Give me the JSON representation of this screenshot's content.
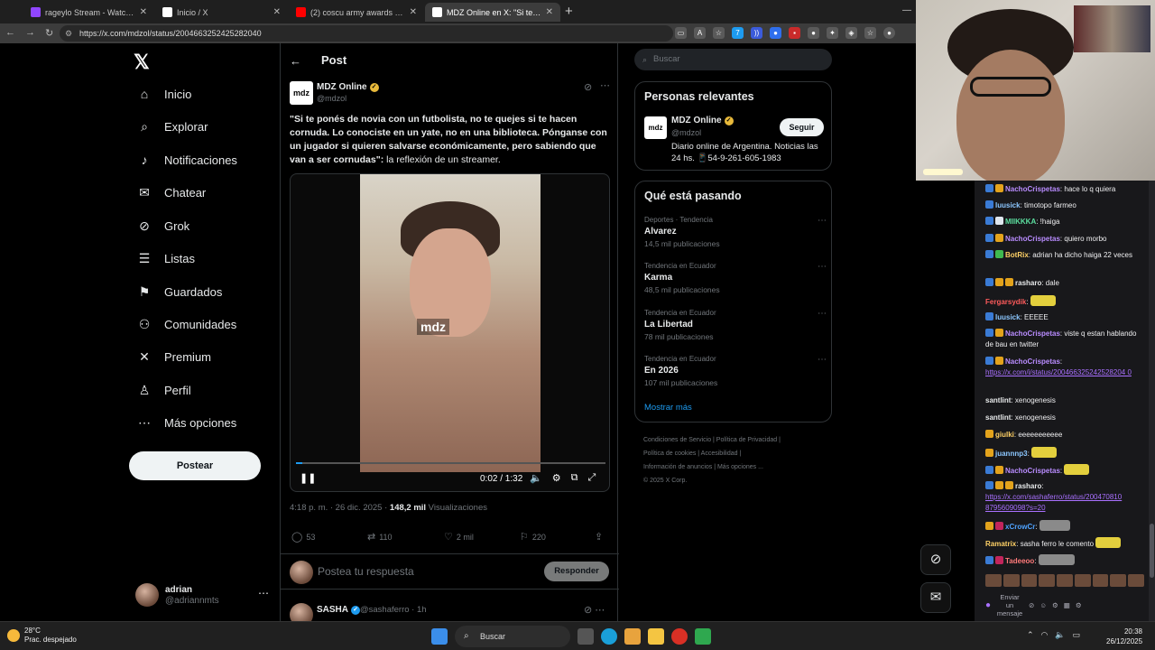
{
  "browser": {
    "tabs": [
      {
        "label": "rageylo Stream - Watch Live o",
        "color": "#9146ff"
      },
      {
        "label": "Inicio / X",
        "color": "#000000"
      },
      {
        "label": "(2) coscu army awards musica - Yo",
        "color": "#ff0000"
      },
      {
        "label": "MDZ Online en X: \"Si te poné",
        "color": "#000000"
      }
    ],
    "url": "https://x.com/mdzol/status/2004663252425282040"
  },
  "nav": {
    "items": [
      {
        "label": "Inicio",
        "icon": "home-icon",
        "glyph": "⌂"
      },
      {
        "label": "Explorar",
        "icon": "search-icon",
        "glyph": "⌕"
      },
      {
        "label": "Notificaciones",
        "icon": "bell-icon",
        "glyph": "♫"
      },
      {
        "label": "Chatear",
        "icon": "mail-icon",
        "glyph": "✉"
      },
      {
        "label": "Grok",
        "icon": "grok-icon",
        "glyph": "⊘"
      },
      {
        "label": "Listas",
        "icon": "list-icon",
        "glyph": "☰"
      },
      {
        "label": "Guardados",
        "icon": "bookmark-icon",
        "glyph": "⚑"
      },
      {
        "label": "Comunidades",
        "icon": "people-icon",
        "glyph": "⚇"
      },
      {
        "label": "Premium",
        "icon": "x-premium-icon",
        "glyph": "✕"
      },
      {
        "label": "Perfil",
        "icon": "person-icon",
        "glyph": "♙"
      },
      {
        "label": "Más opciones",
        "icon": "more-circle-icon",
        "glyph": "⋯"
      }
    ],
    "post_button": "Postear",
    "account": {
      "name": "adrian",
      "handle": "@adriannmts"
    }
  },
  "post": {
    "header_title": "Post",
    "author": {
      "name": "MDZ Online",
      "handle": "@mdzol",
      "avatar_text": "mdz"
    },
    "text_bold": "\"Si te ponés de novia con un futbolista, no te quejes si te hacen cornuda. Lo conociste en un yate, no en una biblioteca. Pónganse con un jugador si quieren salvarse económicamente, pero sabiendo que van a ser cornudas\":",
    "text_rest": " la reflexión de un streamer.",
    "video": {
      "logo": "mdz",
      "time": "0:02 / 1:32",
      "progress": 0.02
    },
    "timestamp": "4:18 p. m. · 26 dic. 2025 · ",
    "views_count": "148,2 mil",
    "views_label": " Visualizaciones",
    "stats": {
      "replies": "53",
      "reposts": "110",
      "likes": "2 mil",
      "bookmarks": "220"
    },
    "reply_placeholder": "Postea tu respuesta",
    "reply_button": "Responder",
    "next_reply": {
      "name": "SASHA",
      "handle": "@sashaferro · 1h"
    }
  },
  "sidebar": {
    "search_placeholder": "Buscar",
    "relevant": {
      "title": "Personas relevantes",
      "name": "MDZ Online",
      "handle": "@mdzol",
      "follow": "Seguir",
      "bio": "Diario online de Argentina. Noticias las 24 hs. 📱54-9-261-605-1983",
      "avatar_text": "mdz"
    },
    "trends_title": "Qué está pasando",
    "trends": [
      {
        "context": "Deportes · Tendencia",
        "name": "Alvarez",
        "count": "14,5 mil publicaciones"
      },
      {
        "context": "Tendencia en Ecuador",
        "name": "Karma",
        "count": "48,5 mil publicaciones"
      },
      {
        "context": "Tendencia en Ecuador",
        "name": "La Libertad",
        "count": "78 mil publicaciones"
      },
      {
        "context": "Tendencia en Ecuador",
        "name": "En 2026",
        "count": "107 mil publicaciones"
      }
    ],
    "show_more": "Mostrar más",
    "footer": {
      "line1": "Condiciones de Servicio  |  Política de Privacidad  |",
      "line2": "Política de cookies  |  Accesibilidad  |",
      "line3": "Información de anuncios  |  Más opciones ...",
      "line4": "© 2025 X Corp."
    }
  },
  "chat": {
    "messages": [
      {
        "user": "NachoCrispetas",
        "color": "#b98cff",
        "text": ": hace lo q quiera"
      },
      {
        "user": "luusick",
        "color": "#8cc7ff",
        "text": ": timotopo farmeo"
      },
      {
        "user": "MIIKKKA",
        "color": "#5ce0a0",
        "text": ": !haiga"
      },
      {
        "user": "NachoCrispetas",
        "color": "#b98cff",
        "text": ": quiero morbo"
      },
      {
        "user": "BotRix",
        "color": "#ffd166",
        "text": ": adrian ha dicho haiga 22 veces"
      },
      {
        "user": "rasharo",
        "color": "#e7e9ea",
        "text": ": dale"
      },
      {
        "user": "Fergarsydik",
        "color": "#ff5b5b",
        "text": ":"
      },
      {
        "user": "luusick",
        "color": "#8cc7ff",
        "text": ": EEEEE"
      },
      {
        "user": "NachoCrispetas",
        "color": "#b98cff",
        "text": ": viste q estan hablando de bau en twitter"
      },
      {
        "user": "NachoCrispetas",
        "color": "#b98cff",
        "text": ":"
      },
      {
        "user": "",
        "color": "#a970ff",
        "text": "https://x.com/i/status/200466325242528204 0"
      },
      {
        "user": "santlint",
        "color": "#e7e9ea",
        "text": ": xenogenesis"
      },
      {
        "user": "santlint",
        "color": "#e7e9ea",
        "text": ": xenogenesis"
      },
      {
        "user": "giulki",
        "color": "#ffd166",
        "text": ": eeeeeeeeeee"
      },
      {
        "user": "juannnp3",
        "color": "#8cc7ff",
        "text": ":"
      },
      {
        "user": "NachoCrispetas",
        "color": "#b98cff",
        "text": ":"
      },
      {
        "user": "rasharo",
        "color": "#e7e9ea",
        "text": ":"
      },
      {
        "user": "",
        "color": "#a970ff",
        "text": "https://x.com/sashaferro/status/200470810 8795609098?s=20"
      },
      {
        "user": "xCrowCr",
        "color": "#4fa3ff",
        "text": ":"
      },
      {
        "user": "Ramatrix",
        "color": "#ffd166",
        "text": ": sasha ferro le comento"
      },
      {
        "user": "Tadeeoo",
        "color": "#ff7a7a",
        "text": ":"
      }
    ],
    "send_label": "Enviar un mensaje"
  },
  "taskbar": {
    "temp": "28°C",
    "weather": "Prac. despejado",
    "search": "Buscar",
    "time": "20:38",
    "date": "26/12/2025"
  }
}
